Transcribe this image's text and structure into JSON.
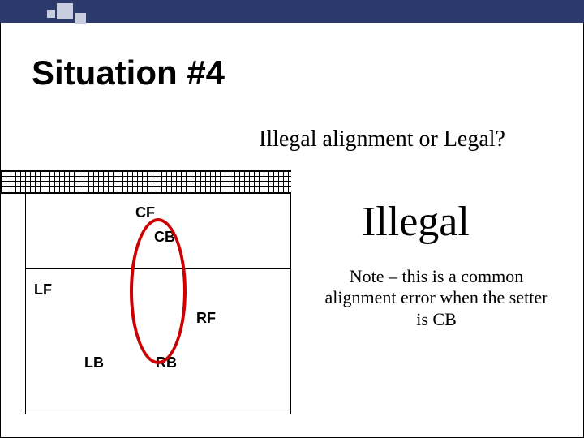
{
  "title": "Situation #4",
  "subtitle": "Illegal alignment or Legal?",
  "verdict": "Illegal",
  "note": "Note – this is a common alignment error when the setter is CB",
  "positions": {
    "cf": "CF",
    "cb": "CB",
    "lf": "LF",
    "rf": "RF",
    "lb": "LB",
    "rb": "RB"
  }
}
